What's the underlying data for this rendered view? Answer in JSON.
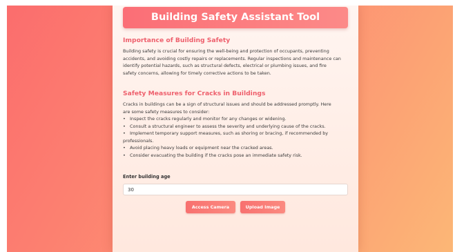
{
  "app": {
    "title": "Building Safety Assistant Tool"
  },
  "importance": {
    "heading": "Importance of Building Safety",
    "lines": [
      "Building safety is crucial for ensuring the well-being and protection of occupants, preventing",
      "accidents, and avoiding costly repairs or replacements. Regular inspections and maintenance can",
      "identify potential hazards, such as structural defects, electrical or plumbing issues, and fire",
      "safety concerns, allowing for timely corrective actions to be taken."
    ]
  },
  "cracks": {
    "heading": "Safety Measures for Cracks in Buildings",
    "intro_lines": [
      "Cracks in buildings can be a sign of structural issues and should be addressed promptly. Here",
      "are some safety measures to consider:"
    ],
    "bullet_symbol": "•",
    "bullets": [
      {
        "lines": [
          "Inspect the cracks regularly and monitor for any changes or widening."
        ]
      },
      {
        "lines": [
          "Consult a structural engineer to assess the severity and underlying cause of the cracks."
        ]
      },
      {
        "lines": [
          "Implement temporary support measures, such as shoring or bracing, if recommended by",
          "professionals."
        ]
      },
      {
        "lines": [
          "Avoid placing heavy loads or equipment near the cracked areas."
        ]
      },
      {
        "lines": [
          "Consider evacuating the building if the cracks pose an immediate safety risk."
        ]
      }
    ]
  },
  "form": {
    "age_label": "Enter building age",
    "age_value": "30"
  },
  "actions": {
    "camera_label": "Access Camera",
    "upload_label": "Upload Image"
  },
  "colors": {
    "accent": "#ee5f6c",
    "button": "#f8706f",
    "background_start": "#fb6d6d",
    "background_end": "#fcb776"
  }
}
